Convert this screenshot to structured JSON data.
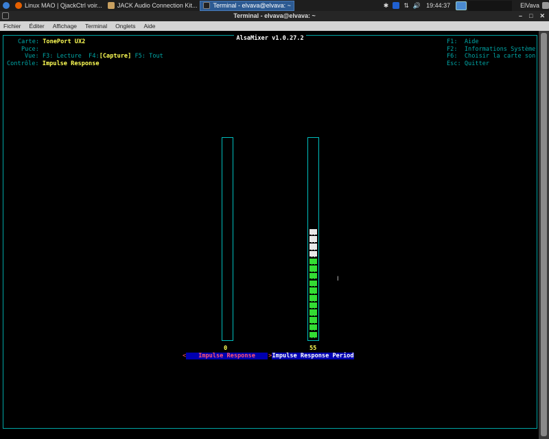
{
  "taskbar": {
    "tasks": [
      {
        "label": "Linux MAO | QjackCtrl voir...",
        "active": false
      },
      {
        "label": "JACK Audio Connection Kit...",
        "active": false
      },
      {
        "label": "Terminal - elvava@elvava: ~",
        "active": true
      }
    ],
    "clock": "19:44:37",
    "user": "ElVava"
  },
  "window": {
    "title": "Terminal - elvava@elvava: ~",
    "menu": [
      "Fichier",
      "Éditer",
      "Affichage",
      "Terminal",
      "Onglets",
      "Aide"
    ]
  },
  "alsamixer": {
    "title": "AlsaMixer v1.0.27.2",
    "info": {
      "card_label": "Carte:",
      "card": "TonePort UX2",
      "chip_label": "Puce:",
      "chip": "",
      "view_label": "Vue:",
      "view_f3": "F3: Lecture",
      "view_f4_key": "F4:",
      "view_f4": "[Capture]",
      "view_f5": "F5: Tout",
      "control_label": "Contrôle:",
      "control": "Impulse Response"
    },
    "help": [
      "F1:  Aide",
      "F2:  Informations Système",
      "F6:  Choisir la carte son",
      "Esc: Quitter"
    ],
    "controls": [
      {
        "name": "Impulse Response",
        "value": "0",
        "level": 0,
        "selected": true
      },
      {
        "name": "Impulse Response Period",
        "value": "55",
        "level": 0.55,
        "selected": false
      }
    ],
    "colors": {
      "frame": "#00a8a8",
      "label_bg": "#0000b0",
      "selected_text": "#ff5577",
      "green": "#33dd33",
      "white": "#e8e8e8"
    }
  }
}
